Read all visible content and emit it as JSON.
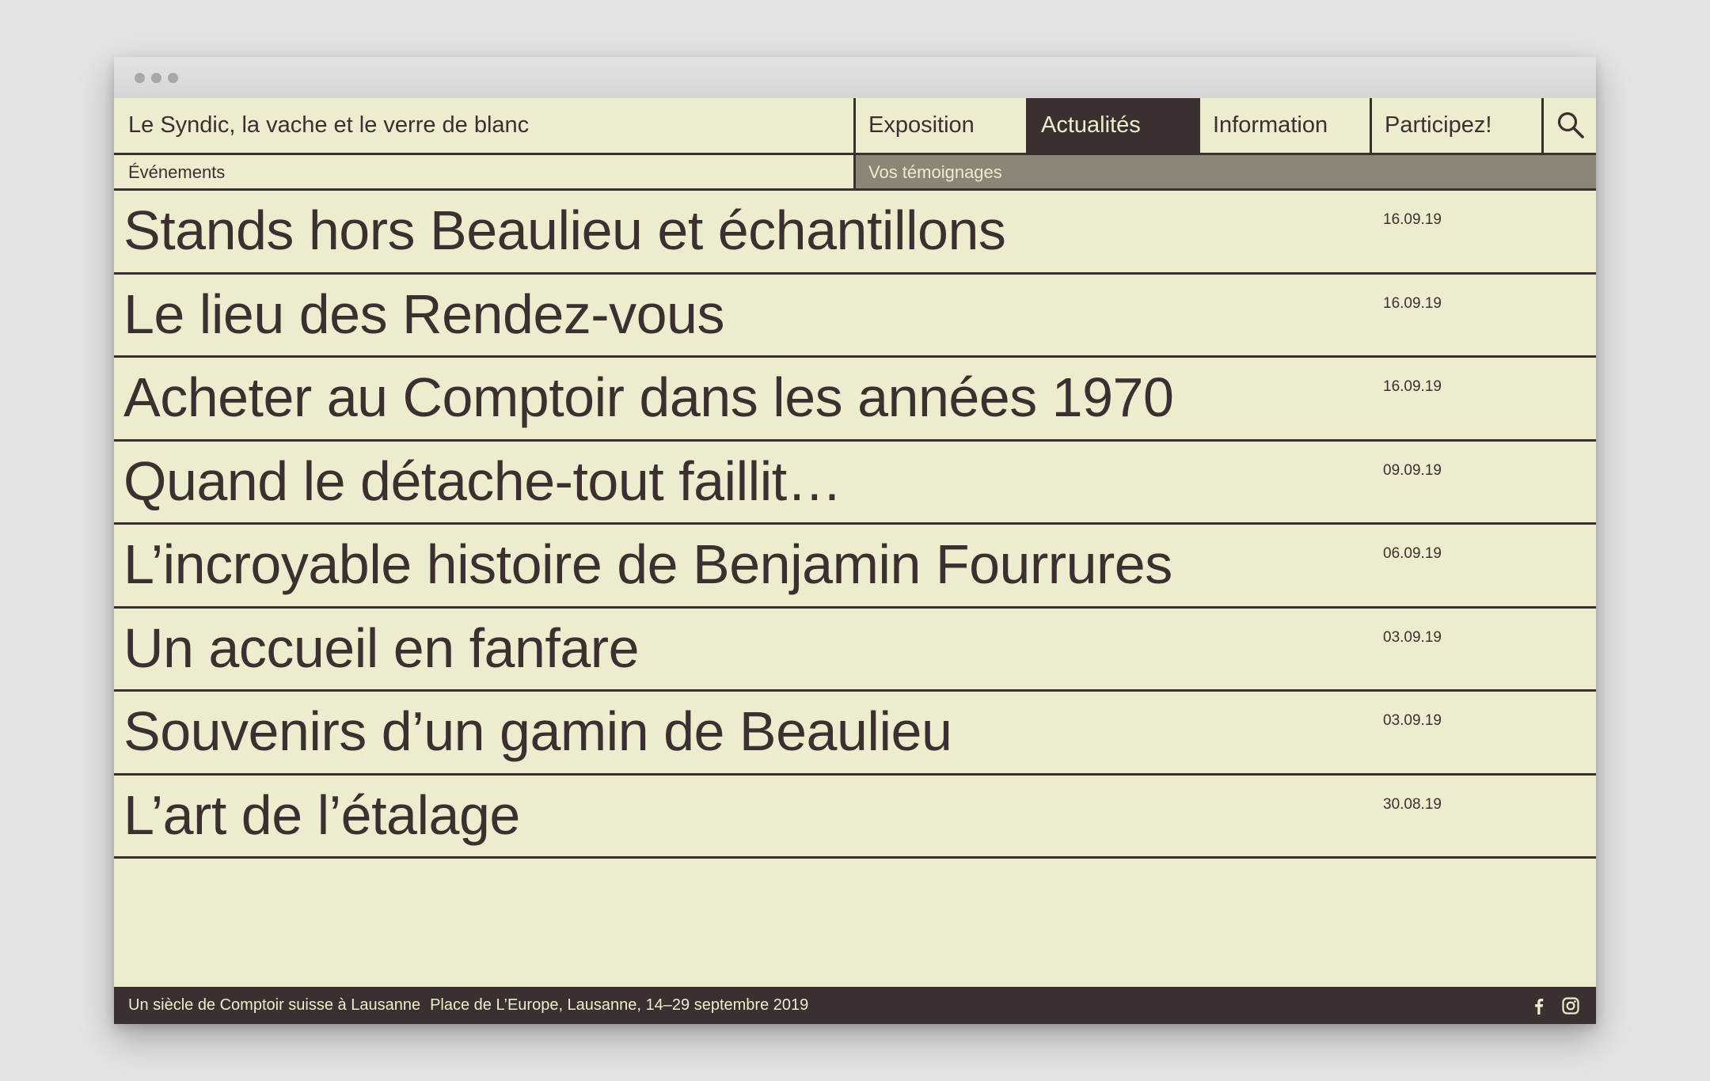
{
  "header": {
    "site_title": "Le Syndic, la vache et le verre de blanc",
    "nav": [
      {
        "label": "Exposition",
        "active": false
      },
      {
        "label": "Actualités",
        "active": true
      },
      {
        "label": "Information",
        "active": false
      },
      {
        "label": "Participez!",
        "active": false
      }
    ],
    "search_icon": "search-icon"
  },
  "subnav": {
    "left": "Événements",
    "right": "Vos témoignages"
  },
  "articles": [
    {
      "title": "Stands hors Beaulieu et échantillons",
      "date": "16.09.19"
    },
    {
      "title": "Le lieu des Rendez-vous",
      "date": "16.09.19"
    },
    {
      "title": "Acheter au Comptoir dans les années 1970",
      "date": "16.09.19"
    },
    {
      "title": "Quand le détache-tout faillit…",
      "date": "09.09.19"
    },
    {
      "title": "L’incroyable histoire de Benjamin Fourrures",
      "date": "06.09.19"
    },
    {
      "title": "Un accueil en fanfare",
      "date": "03.09.19"
    },
    {
      "title": "Souvenirs d’un gamin de Beaulieu",
      "date": "03.09.19"
    },
    {
      "title": "L’art de l’étalage",
      "date": "30.08.19"
    }
  ],
  "footer": {
    "tagline": "Un siècle de Comptoir suisse à Lausanne",
    "location": "Place de L’Europe, Lausanne, 14–29 septembre 2019",
    "icons": [
      "facebook-icon",
      "instagram-icon"
    ]
  },
  "colors": {
    "background": "#eeeccf",
    "dark": "#3a3030",
    "subnav_active": "#8b8677",
    "page": "#e3e3e3"
  }
}
